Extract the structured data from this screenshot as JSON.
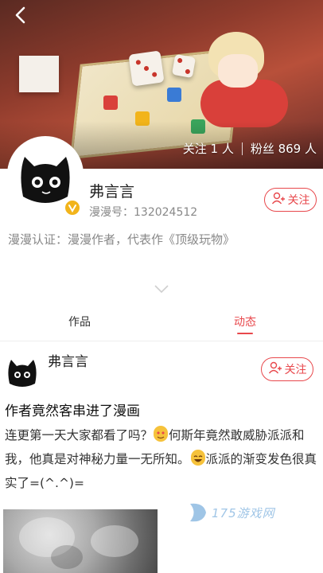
{
  "header": {
    "back_icon": "back-arrow-icon",
    "following_label": "关注 1 人",
    "fans_label": "粉丝 869 人"
  },
  "profile": {
    "name": "弗言言",
    "manman_id": "漫漫号：132024512",
    "follow_label": "关注",
    "certification": "漫漫认证：漫漫作者，代表作《顶级玩物》",
    "verified_icon": "verified-badge-icon",
    "accent_color": "#e8484c",
    "badge_color": "#f2b41b"
  },
  "tabs": [
    {
      "label": "作品",
      "active": false
    },
    {
      "label": "动态",
      "active": true
    }
  ],
  "post": {
    "author": "弗言言",
    "follow_label": "关注",
    "title": "作者竟然客串进了漫画",
    "body_part1": "连更第一天大家都看了吗？",
    "body_part2": "何斯年竟然敢威胁派派和我，他真是对神秘力量一无所知。",
    "body_part3": "派派的渐变发色很真实了=(^.^)="
  },
  "watermark": {
    "text": "175游戏网"
  }
}
